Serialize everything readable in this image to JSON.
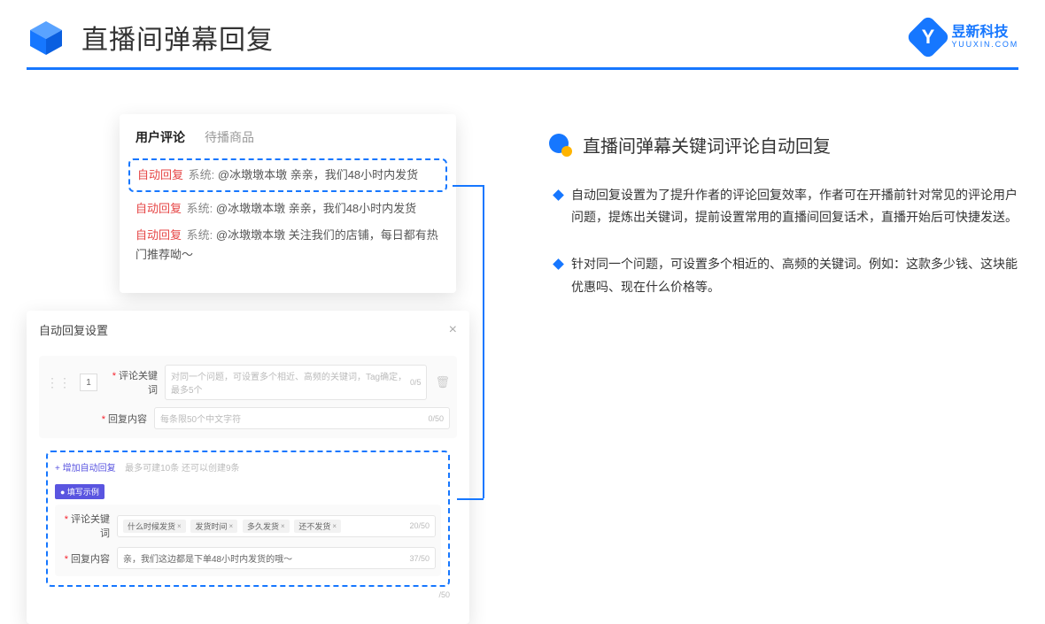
{
  "header": {
    "title": "直播间弹幕回复",
    "brand_cn": "昱新科技",
    "brand_en": "YUUXIN.COM"
  },
  "comments_panel": {
    "tabs": [
      "用户评论",
      "待播商品"
    ],
    "items": [
      {
        "tag": "自动回复",
        "sys": "系统:",
        "text": "@冰墩墩本墩 亲亲，我们48小时内发货"
      },
      {
        "tag": "自动回复",
        "sys": "系统:",
        "text": "@冰墩墩本墩 亲亲，我们48小时内发货"
      },
      {
        "tag": "自动回复",
        "sys": "系统:",
        "text": "@冰墩墩本墩 关注我们的店铺，每日都有热门推荐呦～"
      }
    ]
  },
  "settings_panel": {
    "title": "自动回复设置",
    "index": "1",
    "label_keyword": "评论关键词",
    "placeholder_keyword": "对同一个问题，可设置多个相近、高频的关键词，Tag确定，最多5个",
    "count_keyword": "0/5",
    "label_content": "回复内容",
    "placeholder_content": "每条限50个中文字符",
    "count_content": "0/50",
    "add_link": "+ 增加自动回复",
    "add_hint": "最多可建10条 还可以创建9条",
    "example_badge": "● 填写示例",
    "example_keyword_label": "评论关键词",
    "example_tags": [
      "什么时候发货",
      "发货时间",
      "多久发货",
      "还不发货"
    ],
    "example_keyword_count": "20/50",
    "example_content_label": "回复内容",
    "example_content_value": "亲，我们这边都是下单48小时内发货的哦～",
    "example_content_count": "37/50",
    "extra_count": "/50"
  },
  "right": {
    "section_title": "直播间弹幕关键词评论自动回复",
    "bullets": [
      "自动回复设置为了提升作者的评论回复效率，作者可在开播前针对常见的评论用户问题，提炼出关键词，提前设置常用的直播间回复话术，直播开始后可快捷发送。",
      "针对同一个问题，可设置多个相近的、高频的关键词。例如：这款多少钱、这块能优惠吗、现在什么价格等。"
    ]
  }
}
